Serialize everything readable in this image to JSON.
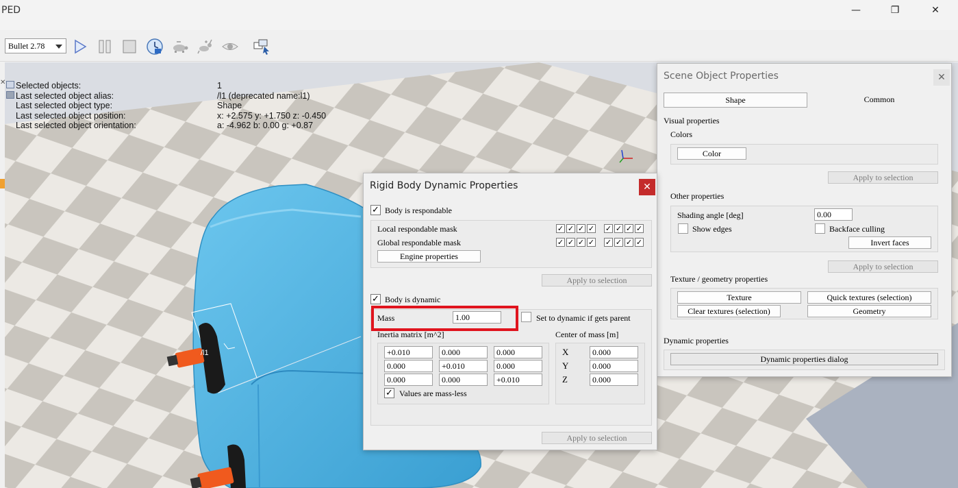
{
  "window": {
    "title": "PED",
    "minimize": "—",
    "restore": "❐",
    "close": "✕"
  },
  "toolbar": {
    "engine": "Bullet 2.78",
    "icons": [
      "play-icon",
      "pause-icon",
      "stop-icon",
      "realtime-clock-icon",
      "slow-turtle-icon",
      "fast-rabbit-icon",
      "visualize-eye-icon",
      "window-layout-icon"
    ]
  },
  "info": {
    "rows": [
      {
        "label": "Selected objects:",
        "value": "1"
      },
      {
        "label": "Last selected object alias:",
        "value": "/l1    (deprecated name:l1)"
      },
      {
        "label": "Last selected object type:",
        "value": "Shape"
      },
      {
        "label": "Last selected object position:",
        "value": "x: +2.575    y: +1.750    z: -0.450"
      },
      {
        "label": "Last selected object orientation:",
        "value": "a: -4.962    b: 0.00    g: +0.87"
      }
    ],
    "scene_label": "/l1"
  },
  "rigid_body": {
    "title": "Rigid Body Dynamic Properties",
    "close": "✕",
    "respondable_label": "Body is respondable",
    "local_mask_label": "Local respondable mask",
    "global_mask_label": "Global respondable mask",
    "engine_properties": "Engine properties",
    "apply_to_selection": "Apply to selection",
    "dynamic_label": "Body is dynamic",
    "mass_label": "Mass",
    "mass_value": "1.00",
    "set_dynamic_label": "Set to dynamic if gets parent",
    "inertia_label": "Inertia matrix [m^2]",
    "inertia": [
      [
        "+0.010",
        "0.000",
        "0.000"
      ],
      [
        "0.000",
        "+0.010",
        "0.000"
      ],
      [
        "0.000",
        "0.000",
        "+0.010"
      ]
    ],
    "massless_label": "Values are mass-less",
    "com_label": "Center of mass [m]",
    "com": [
      {
        "axis": "X",
        "value": "0.000"
      },
      {
        "axis": "Y",
        "value": "0.000"
      },
      {
        "axis": "Z",
        "value": "0.000"
      }
    ],
    "apply_bottom": "Apply to selection",
    "highlight_color": "#e0141e",
    "check": "✓"
  },
  "scene_props": {
    "title": "Scene Object Properties",
    "close": "✕",
    "tab_shape": "Shape",
    "tab_common": "Common",
    "visual_label": "Visual properties",
    "colors_label": "Colors",
    "color_button": "Color",
    "apply_1": "Apply to selection",
    "other_label": "Other properties",
    "shading_label": "Shading angle [deg]",
    "shading_value": "0.00",
    "show_edges": "Show edges",
    "backface": "Backface culling",
    "invert_faces": "Invert faces",
    "apply_2": "Apply to selection",
    "texture_label": "Texture / geometry properties",
    "texture_btn": "Texture",
    "quick_textures": "Quick textures (selection)",
    "clear_textures": "Clear textures (selection)",
    "geometry_btn": "Geometry",
    "dynamic_label": "Dynamic properties",
    "dynamic_dialog": "Dynamic properties dialog"
  },
  "colors": {
    "shape_blue": "#4ab0e0",
    "tile_light": "#ece9e4",
    "tile_dark": "#c9c5be",
    "accent_orange": "#f0a030"
  }
}
